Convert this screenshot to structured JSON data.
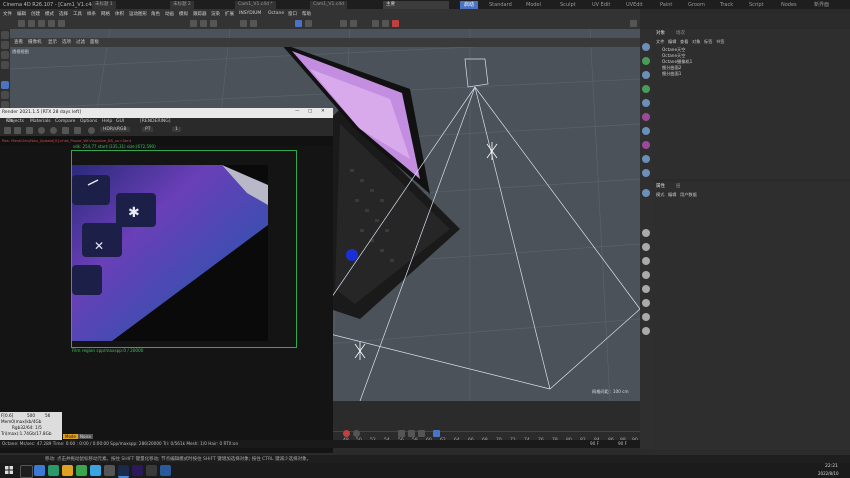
{
  "window": {
    "title": "Cinema 4D R26.107 - [Cam1_V1.c4d *] - 主要",
    "doc_tabs": [
      "未标题 1",
      "未标题 2",
      "Cam1_V1.c4d *",
      "Cam1_V1.c4d",
      "主要"
    ],
    "active_tab_index": 4,
    "layout_tabs": [
      "启动",
      "Standard",
      "Model",
      "Sculpt",
      "UV Edit",
      "UVEdit",
      "Paint",
      "Groom",
      "Track",
      "Script",
      "Nodes",
      "新界面"
    ],
    "active_layout_index": 0
  },
  "menubar": {
    "items": [
      "文件",
      "编辑",
      "创建",
      "模式",
      "选择",
      "工具",
      "样条",
      "网格",
      "体积",
      "运动图形",
      "角色",
      "动画",
      "模拟",
      "跟踪器",
      "渲染",
      "扩展",
      "INSYDIUM",
      "Octane",
      "窗口",
      "帮助"
    ]
  },
  "viewport": {
    "menu": [
      "查看",
      "摄像机",
      "显示",
      "选项",
      "过滤",
      "面板"
    ],
    "label": "透视视图",
    "grid_label": "网格间距 : 100 cm",
    "bg": "#4b525a"
  },
  "object_manager": {
    "tabs": [
      "对象",
      "场次"
    ],
    "menu": [
      "文件",
      "编辑",
      "查看",
      "对象",
      "标签",
      "书签"
    ],
    "objects": [
      "Octane天空",
      "Octane天空",
      "Octane摄像机1",
      "细分曲面2",
      "细分曲面1"
    ]
  },
  "attribute_manager": {
    "tabs": [
      "属性",
      "层"
    ],
    "menu": [
      "模式",
      "编辑",
      "用户数据"
    ]
  },
  "render_window": {
    "title": "Render 2021.1.5 [RTX 28 days left]",
    "menu": [
      "File",
      "Objects",
      "Materials",
      "Compare",
      "Options",
      "Help",
      "GUI"
    ],
    "rendering_label": "[RENDERING]",
    "colorspace": "HDR/sRGB",
    "kernel": "PT",
    "value_field": "1",
    "status": "Res: MeshGen/Neo_Update[0]-chat_Pause_Wf-Visualize_BS_sn=Sent",
    "region_info": "sdk: 254,77 start:(335,31) size:(672,590)",
    "footer": "Film region spp/maxspp:0 / 20000",
    "stats": [
      "F[0.6]",
      "500",
      "56",
      "Mem0(max)kb/4Gb",
      "Rgb32/64: 1/5",
      "Tri(max):1.74Gb/17.8Gb"
    ],
    "stats_buttons": [
      "Mode",
      "Noise"
    ]
  },
  "timeline": {
    "frames": [
      "48",
      "50",
      "52",
      "54",
      "56",
      "58",
      "60",
      "62",
      "64",
      "66",
      "68",
      "70",
      "72",
      "74",
      "76",
      "78",
      "80",
      "82",
      "84",
      "86",
      "88",
      "90"
    ],
    "start": "90 F",
    "end": "90 F"
  },
  "octane_status": "Octane:   Ms/sec: 47.289   Time: 0:00 : 0:00 / 0:00:00   Spp/maxspp: 286/20000  Tri: 0/561k   Mesh: 1/0  Hair: 0   RTX:on",
  "status_bar": "移动: 点击并拖动鼠标移动元素。按住 SHIFT 键量化移动; 节点编辑模式时按住 SHIFT 键增加选择对象; 按住 CTRL 键减少选择对象。",
  "taskbar": {
    "time": "22:21",
    "date": "2022/8/10",
    "search_placeholder": ""
  }
}
